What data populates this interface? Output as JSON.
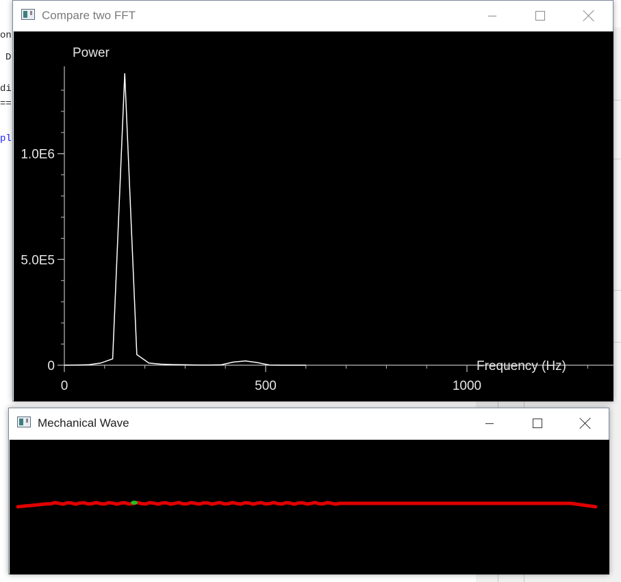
{
  "background_editor": {
    "fragments": [
      "on",
      "D",
      "di",
      "==",
      "pl"
    ]
  },
  "fft_window": {
    "title": "Compare two FFT",
    "icon": "app-window-icon",
    "controls": [
      "minimize-icon",
      "maximize-icon",
      "close-icon"
    ]
  },
  "wave_window": {
    "title": "Mechanical Wave",
    "icon": "app-window-icon",
    "controls": [
      "minimize-icon",
      "maximize-icon",
      "close-icon"
    ],
    "wave_color": "#e00000",
    "marker_color": "#22c022"
  },
  "chart_data": {
    "type": "line",
    "title": "",
    "ylabel": "Power",
    "xlabel": "Frequency (Hz)",
    "xlim": [
      0,
      1380
    ],
    "ylim": [
      0,
      1400000
    ],
    "x_ticks": [
      {
        "value": 0,
        "label": "0"
      },
      {
        "value": 500,
        "label": "500"
      },
      {
        "value": 1000,
        "label": "1000"
      }
    ],
    "y_ticks": [
      {
        "value": 0,
        "label": "0"
      },
      {
        "value": 500000,
        "label": "5.0E5"
      },
      {
        "value": 1000000,
        "label": "1.0E6"
      }
    ],
    "grid": false,
    "background": "#000000",
    "line_color": "#ffffff",
    "series": [
      {
        "x": [
          0,
          30,
          60,
          90,
          120,
          150,
          180,
          210,
          240,
          270,
          300,
          330,
          360,
          390,
          420,
          450,
          480,
          510,
          540,
          570,
          600
        ],
        "values": [
          0,
          1000,
          2000,
          10000,
          30000,
          1380000,
          50000,
          10000,
          5000,
          3000,
          2000,
          1000,
          1000,
          2000,
          15000,
          20000,
          12000,
          1000,
          0,
          0,
          0
        ]
      }
    ]
  }
}
